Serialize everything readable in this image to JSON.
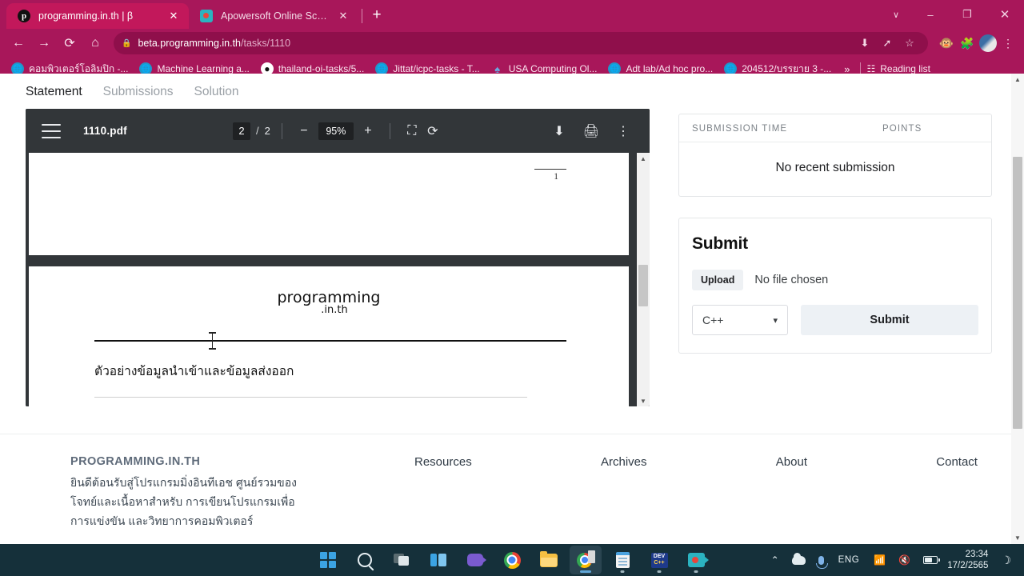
{
  "browser": {
    "tabs": [
      {
        "title": "programming.in.th | β",
        "favicon": "p-logo-icon",
        "active": true
      },
      {
        "title": "Apowersoft Online Screen Record",
        "favicon": "screen-recorder-icon",
        "active": false
      }
    ],
    "new_tab_label": "+",
    "window_controls": {
      "chevron": "∨",
      "minimize": "–",
      "maximize": "❐",
      "close": "✕"
    },
    "nav": {
      "back": "←",
      "forward": "→",
      "reload": "⟳",
      "home": "⌂"
    },
    "omnibox": {
      "lock_icon": "lock-icon",
      "url_strong": "beta.programming.in.th",
      "url_dim": "/tasks/1110",
      "actions": [
        "install-icon",
        "share-icon",
        "bookmark-star-icon"
      ]
    },
    "extensions": [
      "monkey-icon",
      "puzzle-icon",
      "globe-icon"
    ],
    "menu": "⋮",
    "bookmarks": [
      {
        "label": "คอมพิวเตอร์โอลิมปิก -...",
        "icon": "globe-icon"
      },
      {
        "label": "Machine Learning a...",
        "icon": "globe-icon"
      },
      {
        "label": "thailand-oi-tasks/5...",
        "icon": "github-icon"
      },
      {
        "label": "Jittat/icpc-tasks - T...",
        "icon": "globe-icon"
      },
      {
        "label": "USA Computing Ol...",
        "icon": "usaco-icon"
      },
      {
        "label": "Adt lab/Ad hoc pro...",
        "icon": "globe-icon"
      },
      {
        "label": "204512/บรรยาย 3 -...",
        "icon": "globe-icon"
      }
    ],
    "bookmarks_overflow": "»",
    "reading_list": {
      "label": "Reading list",
      "icon": "reading-list-icon"
    }
  },
  "page": {
    "tabs": [
      {
        "label": "Statement",
        "active": true
      },
      {
        "label": "Submissions",
        "active": false
      },
      {
        "label": "Solution",
        "active": false
      }
    ],
    "pdf_viewer": {
      "menu_icon": "hamburger-icon",
      "file_name": "1110.pdf",
      "current_page": "2",
      "page_separator": "/",
      "total_pages": "2",
      "zoom_out": "−",
      "zoom_level": "95%",
      "zoom_in": "+",
      "fit_icon": "fit-page-icon",
      "rotate_icon": "rotate-icon",
      "download_icon": "download-icon",
      "print_icon": "print-icon",
      "more_icon": "more-vertical-icon",
      "doc": {
        "page1_number": "1",
        "logo_line1": "programming",
        "logo_line2": ".in.th",
        "heading": "ตัวอย่างข้อมูลนำเข้าและข้อมูลส่งออก"
      }
    },
    "submissions": {
      "col_time": "SUBMISSION TIME",
      "col_points": "POINTS",
      "empty_text": "No recent submission"
    },
    "submit": {
      "title": "Submit",
      "upload_label": "Upload",
      "file_status": "No file chosen",
      "language": "C++",
      "language_chevron": "∨",
      "submit_label": "Submit"
    },
    "footer": {
      "brand": "PROGRAMMING.IN.TH",
      "desc_line1": "ยินดีต้อนรับสู่โปรแกรมมิ่งอินทีเอช ศูนย์รวมของ",
      "desc_line2": "โจทย์และเนื้อหาสำหรับ การเขียนโปรแกรมเพื่อ",
      "desc_line3": "การแข่งขัน และวิทยาการคอมพิวเตอร์",
      "links": [
        "Resources",
        "Archives",
        "About",
        "Contact"
      ]
    }
  },
  "taskbar": {
    "apps": [
      {
        "name": "start-icon"
      },
      {
        "name": "search-icon"
      },
      {
        "name": "task-view-icon"
      },
      {
        "name": "widgets-icon"
      },
      {
        "name": "teams-icon"
      },
      {
        "name": "chrome-icon"
      },
      {
        "name": "file-explorer-icon"
      },
      {
        "name": "chrome-zip-icon"
      },
      {
        "name": "notepad-icon"
      },
      {
        "name": "devcpp-icon"
      },
      {
        "name": "screen-recorder-icon"
      }
    ],
    "tray": {
      "overflow": "⌃",
      "cloud": "onedrive-icon",
      "mic": "microphone-icon",
      "language": "ENG",
      "wifi": "wifi-icon",
      "volume": "volume-muted-icon",
      "battery": "battery-icon",
      "time": "23:34",
      "date": "17/2/2565",
      "notifications": "☽"
    }
  },
  "colors": {
    "browser_chrome": "#a8175a",
    "active_tab": "#c2185b",
    "pdf_toolbar": "#323639",
    "taskbar": "#15303a"
  }
}
